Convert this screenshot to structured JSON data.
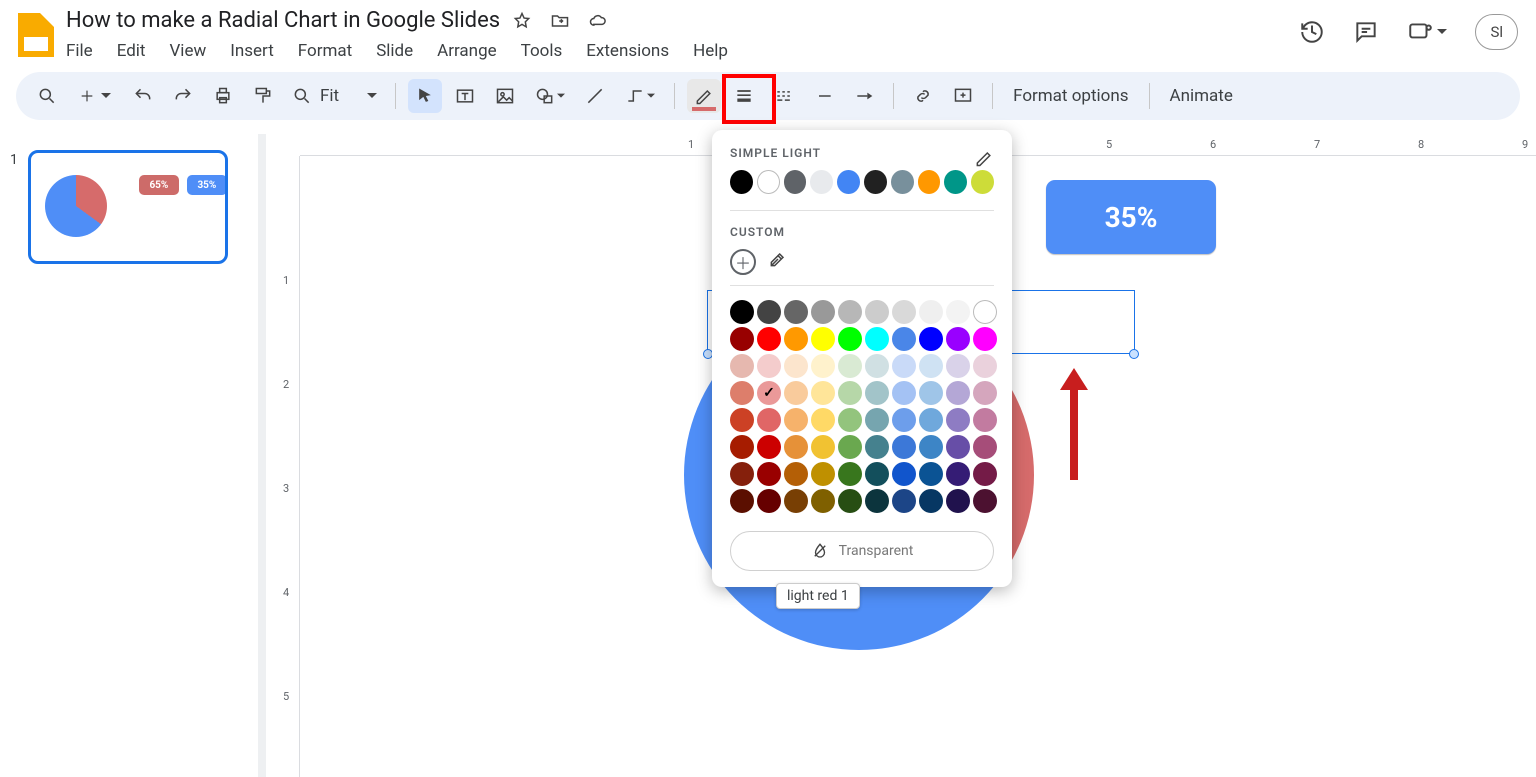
{
  "doc": {
    "title": "How to make a Radial Chart in Google Slides"
  },
  "menu": {
    "items": [
      "File",
      "Edit",
      "View",
      "Insert",
      "Format",
      "Slide",
      "Arrange",
      "Tools",
      "Extensions",
      "Help"
    ]
  },
  "toolbar": {
    "zoom_label": "Fit",
    "format_options": "Format options",
    "animate": "Animate"
  },
  "header_right": {
    "share": "Sl"
  },
  "thumbnails": {
    "index": "1",
    "box1": "65%",
    "box2": "35%"
  },
  "slide": {
    "callout_red": "65%",
    "callout_blue": "35%"
  },
  "popup": {
    "section_theme": "SIMPLE LIGHT",
    "section_custom": "CUSTOM",
    "transparent": "Transparent",
    "tooltip": "light red 1",
    "theme_colors": [
      "#000000",
      "#ffffff",
      "#5f6368",
      "#e8eaed",
      "#4285f4",
      "#212121",
      "#78909c",
      "#ff9800",
      "#009688",
      "#cddc39"
    ],
    "grid_colors": [
      [
        "#000000",
        "#434343",
        "#666666",
        "#999999",
        "#b7b7b7",
        "#cccccc",
        "#d9d9d9",
        "#efefef",
        "#f3f3f3",
        "#ffffff"
      ],
      [
        "#980000",
        "#ff0000",
        "#ff9900",
        "#ffff00",
        "#00ff00",
        "#00ffff",
        "#4a86e8",
        "#0000ff",
        "#9900ff",
        "#ff00ff"
      ],
      [
        "#e6b8af",
        "#f4cccc",
        "#fce5cd",
        "#fff2cc",
        "#d9ead3",
        "#d0e0e3",
        "#c9daf8",
        "#cfe2f3",
        "#d9d2e9",
        "#ead1dc"
      ],
      [
        "#dd7e6b",
        "#ea9999",
        "#f9cb9c",
        "#ffe599",
        "#b6d7a8",
        "#a2c4c9",
        "#a4c2f4",
        "#9fc5e8",
        "#b4a7d6",
        "#d5a6bd"
      ],
      [
        "#cc4125",
        "#e06666",
        "#f6b26b",
        "#ffd966",
        "#93c47d",
        "#76a5af",
        "#6d9eeb",
        "#6fa8dc",
        "#8e7cc3",
        "#c27ba0"
      ],
      [
        "#a61c00",
        "#cc0000",
        "#e69138",
        "#f1c232",
        "#6aa84f",
        "#45818e",
        "#3c78d8",
        "#3d85c6",
        "#674ea7",
        "#a64d79"
      ],
      [
        "#85200c",
        "#990000",
        "#b45f06",
        "#bf9000",
        "#38761d",
        "#134f5c",
        "#1155cc",
        "#0b5394",
        "#351c75",
        "#741b47"
      ],
      [
        "#5b0f00",
        "#660000",
        "#783f04",
        "#7f6000",
        "#274e13",
        "#0c343d",
        "#1c4587",
        "#073763",
        "#20124d",
        "#4c1130"
      ]
    ],
    "selected": {
      "row": 3,
      "col": 1
    }
  },
  "ruler_h": [
    "1",
    "5",
    "6",
    "7",
    "8",
    "9"
  ],
  "ruler_v": [
    "1",
    "2",
    "3",
    "4",
    "5"
  ]
}
